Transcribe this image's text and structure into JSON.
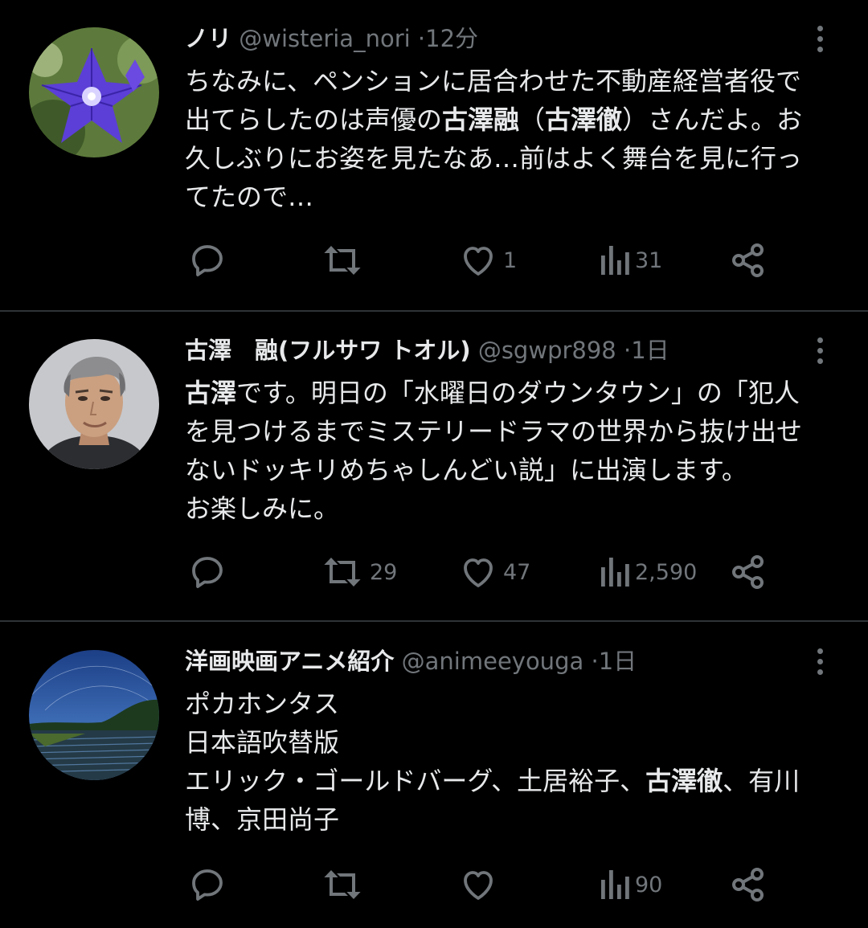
{
  "colors": {
    "background": "#000000",
    "text": "#e7e9ea",
    "muted": "#71767b",
    "divider": "#2f3336"
  },
  "tweets": [
    {
      "name": "ノリ",
      "handle": "@wisteria_nori",
      "separator": "·",
      "time": "12分",
      "avatar": "balloon-flower-avatar",
      "lines": [
        [
          {
            "t": "ちなみに、ペンションに居合わせた不動産経営者役で"
          }
        ],
        [
          {
            "t": "出てらしたのは声優の"
          },
          {
            "t": "古澤融",
            "b": true
          },
          {
            "t": "（"
          },
          {
            "t": "古澤徹",
            "b": true
          },
          {
            "t": "）さんだよ。お"
          }
        ],
        [
          {
            "t": "久しぶりにお姿を見たなあ…前はよく舞台を見に行っ"
          }
        ],
        [
          {
            "t": "てたので…"
          }
        ]
      ],
      "replies": "",
      "retweets": "",
      "likes": "1",
      "views": "31",
      "icons": [
        "reply-icon",
        "retweet-icon",
        "like-icon",
        "views-icon",
        "share-icon"
      ]
    },
    {
      "name": "古澤　融(フルサワ トオル)",
      "handle": "@sgwpr898",
      "separator": "·",
      "time": "1日",
      "avatar": "man-portrait-avatar",
      "lines": [
        [
          {
            "t": "古澤",
            "b": true
          },
          {
            "t": "です。明日の「水曜日のダウンタウン」の「犯人"
          }
        ],
        [
          {
            "t": "を見つけるまでミステリードラマの世界から抜け出せ"
          }
        ],
        [
          {
            "t": "ないドッキリめちゃしんどい説」に出演します。"
          }
        ],
        [
          {
            "t": "お楽しみに。"
          }
        ]
      ],
      "replies": "",
      "retweets": "29",
      "likes": "47",
      "views": "2,590",
      "icons": [
        "reply-icon",
        "retweet-icon",
        "like-icon",
        "views-icon",
        "share-icon"
      ]
    },
    {
      "name": "洋画映画アニメ紹介",
      "handle": "@animeeyouga",
      "separator": "·",
      "time": "1日",
      "avatar": "star-trail-landscape-avatar",
      "lines": [
        [
          {
            "t": "ポカホンタス"
          }
        ],
        [
          {
            "t": "日本語吹替版"
          }
        ],
        [
          {
            "t": "エリック・ゴールドバーグ、土居裕子、"
          },
          {
            "t": "古澤徹",
            "b": true
          },
          {
            "t": "、有川"
          }
        ],
        [
          {
            "t": "博、京田尚子"
          }
        ]
      ],
      "replies": "",
      "retweets": "",
      "likes": "",
      "views": "90",
      "icons": [
        "reply-icon",
        "retweet-icon",
        "like-icon",
        "views-icon",
        "share-icon"
      ]
    }
  ]
}
